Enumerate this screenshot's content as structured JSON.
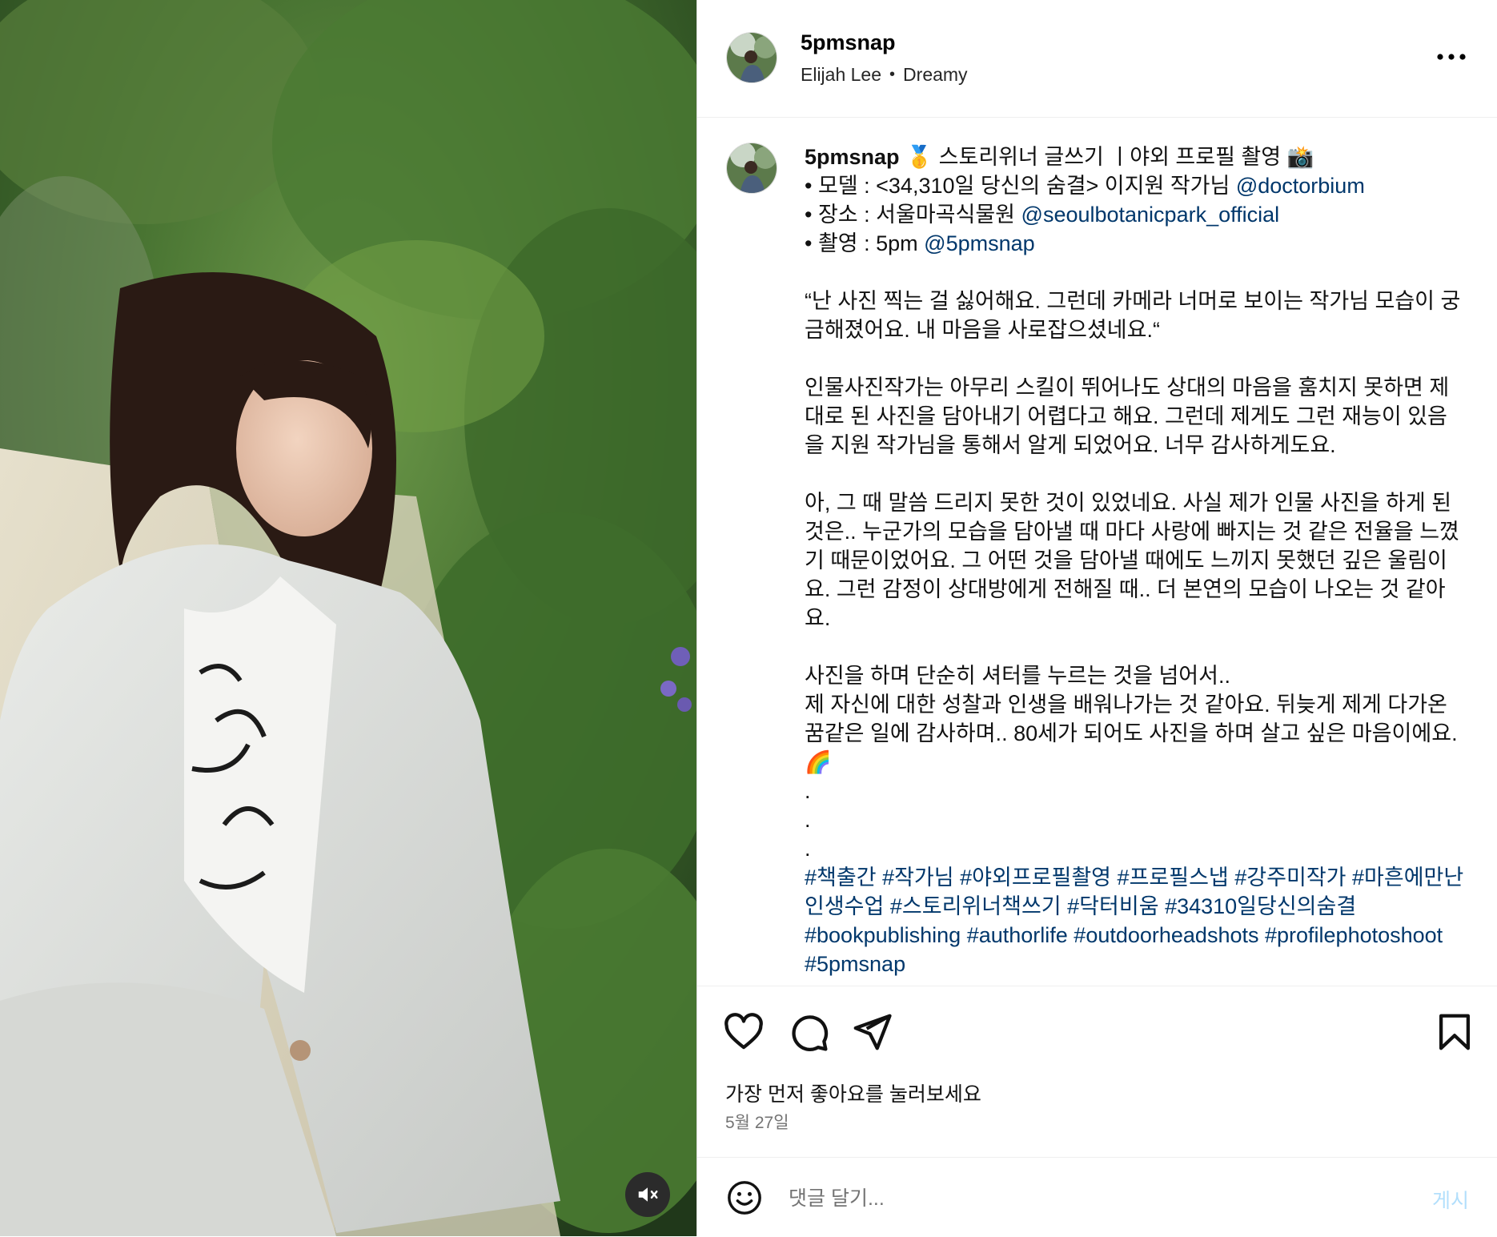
{
  "post": {
    "username": "5pmsnap",
    "audio": {
      "artist": "Elijah Lee",
      "separator": "•",
      "track": "Dreamy"
    }
  },
  "caption": {
    "username": "5pmsnap",
    "lines": [
      {
        "text": "🥇 스토리위너 글쓰기 ㅣ야외 프로필 촬영 📸"
      },
      {
        "text": "• 모델 : <34,310일 당신의 숨결> 이지원 작가님 ",
        "mention": "@doctorbium"
      },
      {
        "text": "• 장소 : 서울마곡식물원 ",
        "mention": "@seoulbotanicpark_official"
      },
      {
        "text": "• 촬영 : 5pm ",
        "mention": "@5pmsnap"
      }
    ],
    "paragraphs": [
      "“난 사진 찍는 걸 싫어해요. 그런데 카메라 너머로 보이는 작가님 모습이 궁금해졌어요. 내 마음을 사로잡으셨네요.“",
      "인물사진작가는 아무리 스킬이 뛰어나도 상대의 마음을 훔치지 못하면 제대로 된 사진을 담아내기 어렵다고 해요. 그런데 제게도 그런 재능이 있음을 지원 작가님을 통해서 알게 되었어요. 너무 감사하게도요.",
      "아, 그 때 말씀 드리지 못한 것이 있었네요. 사실 제가 인물 사진을 하게 된 것은.. 누군가의 모습을 담아낼 때 마다 사랑에 빠지는 것 같은 전율을 느꼈기 때문이었어요. 그 어떤 것을 담아낼 때에도 느끼지 못했던 깊은 울림이요. 그런 감정이 상대방에게 전해질 때.. 더 본연의 모습이 나오는 것 같아요."
    ],
    "closing": [
      "사진을 하며 단순히 셔터를 누르는 것을 넘어서..",
      "제 자신에 대한 성찰과 인생을 배워나가는 것 같아요. 뒤늦게 제게 다가온 꿈같은 일에 감사하며.. 80세가 되어도 사진을 하며 살고 싶은 마음이에요.",
      "🌈",
      ".",
      ".",
      "."
    ],
    "hashtags": [
      "#책출간",
      "#작가님",
      "#야외프로필촬영",
      "#프로필스냅",
      "#강주미작가",
      "#마흔에만난인생수업",
      "#스토리위너책쓰기",
      "#닥터비움",
      "#34310일당신의숨결",
      "#bookpublishing",
      "#authorlife",
      "#outdoorheadshots",
      "#profilephotoshoot",
      "#5pmsnap"
    ]
  },
  "actions": {
    "likes_text": "가장 먼저 좋아요를 눌러보세요",
    "date": "5월 27일"
  },
  "comment": {
    "placeholder": "댓글 달기...",
    "post_label": "게시"
  },
  "icons": {
    "more": "more-horizontal-icon",
    "like": "heart-icon",
    "comment": "comment-bubble-icon",
    "share": "paper-plane-icon",
    "save": "bookmark-icon",
    "emoji": "emoji-smiley-icon",
    "mute": "speaker-muted-icon"
  },
  "colors": {
    "link": "#00376b",
    "secondary_text": "#737373",
    "post_button_disabled": "#b2dffc",
    "border": "#dbdbdb"
  }
}
